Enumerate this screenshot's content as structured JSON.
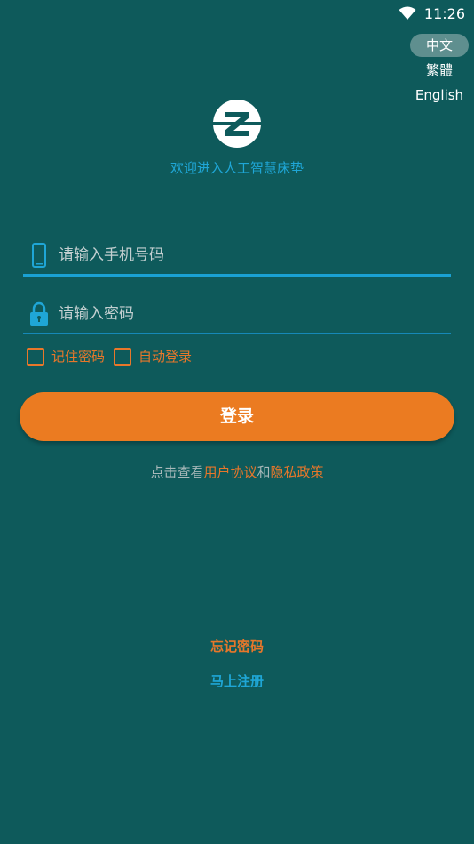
{
  "status_bar": {
    "time": "11:26",
    "wifi_icon": "wifi-icon"
  },
  "language": {
    "options": [
      "中文",
      "繁體",
      "English"
    ],
    "selected": "中文"
  },
  "header": {
    "logo_icon": "z-logo-icon",
    "welcome": "欢迎进入人工智慧床垫"
  },
  "form": {
    "phone_placeholder": "请输入手机号码",
    "phone_icon": "phone-icon",
    "password_placeholder": "请输入密码",
    "password_icon": "lock-icon",
    "remember_label": "记住密码",
    "auto_login_label": "自动登录",
    "login_label": "登录"
  },
  "agreement": {
    "prefix": "点击查看",
    "user_agreement": "用户协议",
    "and": "和",
    "privacy_policy": "隐私政策"
  },
  "links": {
    "forgot_password": "忘记密码",
    "register": "马上注册"
  },
  "colors": {
    "background": "#0e5a5b",
    "accent_orange": "#eb7b21",
    "accent_blue": "#1fa6d6"
  }
}
